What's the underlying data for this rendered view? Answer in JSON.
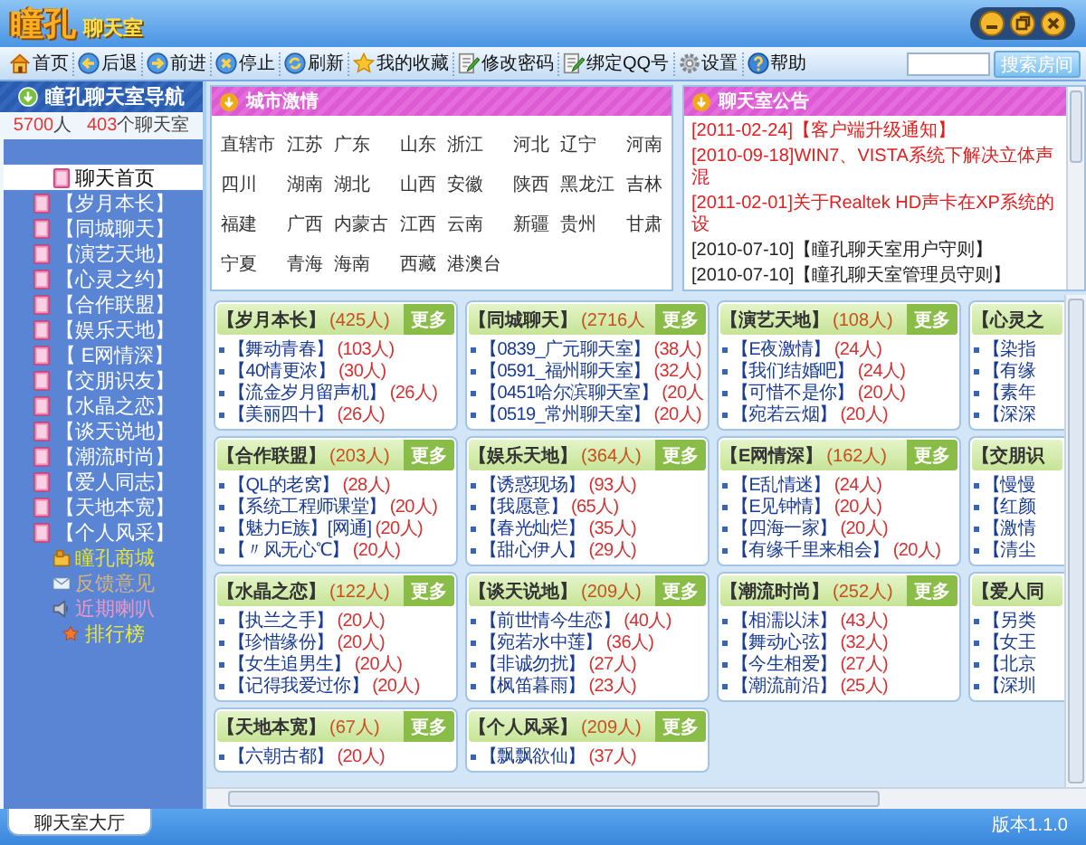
{
  "app": {
    "logo": "瞳孔",
    "logo_sub": "聊天室"
  },
  "toolbar": [
    {
      "label": "首页",
      "kind": "home"
    },
    {
      "label": "后退",
      "kind": "back"
    },
    {
      "label": "前进",
      "kind": "forward"
    },
    {
      "label": "停止",
      "kind": "stop"
    },
    {
      "label": "刷新",
      "kind": "refresh"
    },
    {
      "label": "我的收藏",
      "kind": "star"
    },
    {
      "label": "修改密码",
      "kind": "edit"
    },
    {
      "label": "绑定QQ号",
      "kind": "edit"
    },
    {
      "label": "设置",
      "kind": "gear"
    },
    {
      "label": "帮助",
      "kind": "help"
    }
  ],
  "search": {
    "button": "搜索房间"
  },
  "sidebar": {
    "title": "瞳孔聊天室导航",
    "users": "5700",
    "users_unit": "人",
    "rooms": "403",
    "rooms_unit": "个聊天室",
    "items": [
      {
        "label": "聊天首页",
        "kind": "room",
        "selected": true
      },
      {
        "label": "【岁月本长】",
        "kind": "room",
        "selected": false
      },
      {
        "label": "【同城聊天】",
        "kind": "room",
        "selected": false
      },
      {
        "label": "【演艺天地】",
        "kind": "room",
        "selected": false
      },
      {
        "label": "【心灵之约】",
        "kind": "room",
        "selected": false
      },
      {
        "label": "【合作联盟】",
        "kind": "room",
        "selected": false
      },
      {
        "label": "【娱乐天地】",
        "kind": "room",
        "selected": false
      },
      {
        "label": "【 E网情深】",
        "kind": "room",
        "selected": false
      },
      {
        "label": "【交朋识友】",
        "kind": "room",
        "selected": false
      },
      {
        "label": "【水晶之恋】",
        "kind": "room",
        "selected": false
      },
      {
        "label": "【谈天说地】",
        "kind": "room",
        "selected": false
      },
      {
        "label": "【潮流时尚】",
        "kind": "room",
        "selected": false
      },
      {
        "label": "【爱人同志】",
        "kind": "room",
        "selected": false
      },
      {
        "label": "【天地本宽】",
        "kind": "room",
        "selected": false
      },
      {
        "label": "【个人风采】",
        "kind": "room",
        "selected": false
      },
      {
        "label": "瞳孔商城",
        "kind": "shop",
        "selected": false,
        "color": "#e4e436"
      },
      {
        "label": "反馈意见",
        "kind": "mail",
        "selected": false,
        "color": "#d8b478"
      },
      {
        "label": "近期喇叭",
        "kind": "speaker",
        "selected": false,
        "color": "#e898c8"
      },
      {
        "label": "排行榜",
        "kind": "rank",
        "selected": false,
        "color": "#e8e840"
      }
    ],
    "tab": "聊天室大厅"
  },
  "city_panel": {
    "title": "城市激情",
    "cities": [
      "直辖市",
      "江苏",
      "广东",
      "山东",
      "浙江",
      "河北",
      "辽宁",
      "河南",
      "四川",
      "湖南",
      "湖北",
      "山西",
      "安徽",
      "陕西",
      "黑龙江",
      "吉林",
      "福建",
      "广西",
      "内蒙古",
      "江西",
      "云南",
      "新疆",
      "贵州",
      "甘肃",
      "宁夏",
      "青海",
      "海南",
      "西藏",
      "港澳台"
    ]
  },
  "notice_panel": {
    "title": "聊天室公告",
    "notices": [
      {
        "text": "[2011-02-24]【客户端升级通知】",
        "important": true
      },
      {
        "text": "[2010-09-18]WIN7、VISTA系统下解决立体声混",
        "important": true
      },
      {
        "text": "[2011-02-01]关于Realtek HD声卡在XP系统的设",
        "important": true
      },
      {
        "text": "[2010-07-10]【瞳孔聊天室用户守则】",
        "important": false
      },
      {
        "text": "[2010-07-10]【瞳孔聊天室管理员守则】",
        "important": false
      }
    ]
  },
  "category_rows": [
    [
      {
        "title": "【岁月本长】",
        "count": "(425人)",
        "more": "更多",
        "rooms": [
          {
            "name": "【舞动青春】",
            "count": "(103人)"
          },
          {
            "name": "【40情更浓】",
            "count": "(30人)"
          },
          {
            "name": "【流金岁月留声机】",
            "count": "(26人)"
          },
          {
            "name": "【美丽四十】",
            "count": "(26人)"
          }
        ]
      },
      {
        "title": "【同城聊天】",
        "count": "(2716人",
        "more": "更多",
        "rooms": [
          {
            "name": "【0839_广元聊天室】",
            "count": "(38人)"
          },
          {
            "name": "【0591_福州聊天室】",
            "count": "(32人)"
          },
          {
            "name": "【0451哈尔滨聊天室】",
            "count": "(20人"
          },
          {
            "name": "【0519_常州聊天室】",
            "count": "(20人)"
          }
        ]
      },
      {
        "title": "【演艺天地】",
        "count": "(108人)",
        "more": "更多",
        "rooms": [
          {
            "name": "【E夜激情】",
            "count": "(24人)"
          },
          {
            "name": "【我们结婚吧】",
            "count": "(24人)"
          },
          {
            "name": "【可惜不是你】",
            "count": "(20人)"
          },
          {
            "name": "【宛若云烟】",
            "count": "(20人)"
          }
        ]
      },
      {
        "title": "【心灵之",
        "rooms": [
          {
            "name": "【染指"
          },
          {
            "name": "【有缘"
          },
          {
            "name": "【素年"
          },
          {
            "name": "【深深"
          }
        ]
      }
    ],
    [
      {
        "title": "【合作联盟】",
        "count": "(203人)",
        "more": "更多",
        "rooms": [
          {
            "name": "【QL的老窝】",
            "count": "(28人)"
          },
          {
            "name": "【系统工程师课堂】",
            "count": "(20人)"
          },
          {
            "name": "【魅力E族】[网通]",
            "count": "(20人)"
          },
          {
            "name": "【〃风无心℃】",
            "count": "(20人)"
          }
        ]
      },
      {
        "title": "【娱乐天地】",
        "count": "(364人)",
        "more": "更多",
        "rooms": [
          {
            "name": "【诱惑现场】",
            "count": "(93人)"
          },
          {
            "name": "【我愿意】",
            "count": "(65人)"
          },
          {
            "name": "【春光灿烂】",
            "count": "(35人)"
          },
          {
            "name": "【甜心伊人】",
            "count": "(29人)"
          }
        ]
      },
      {
        "title": "【E网情深】",
        "count": "(162人)",
        "more": "更多",
        "rooms": [
          {
            "name": "【E乱情迷】",
            "count": "(24人)"
          },
          {
            "name": "【E见钟情】",
            "count": "(20人)"
          },
          {
            "name": "【四海一家】",
            "count": "(20人)"
          },
          {
            "name": "【有缘千里来相会】",
            "count": "(20人)"
          }
        ]
      },
      {
        "title": "【交朋识",
        "rooms": [
          {
            "name": "【慢慢"
          },
          {
            "name": "【红颜"
          },
          {
            "name": "【激情"
          },
          {
            "name": "【清尘"
          }
        ]
      }
    ],
    [
      {
        "title": "【水晶之恋】",
        "count": "(122人)",
        "more": "更多",
        "rooms": [
          {
            "name": "【执兰之手】",
            "count": "(20人)"
          },
          {
            "name": "【珍惜缘份】",
            "count": "(20人)"
          },
          {
            "name": "【女生追男生】",
            "count": "(20人)"
          },
          {
            "name": "【记得我爱过你】",
            "count": "(20人)"
          }
        ]
      },
      {
        "title": "【谈天说地】",
        "count": "(209人)",
        "more": "更多",
        "rooms": [
          {
            "name": "【前世情今生恋】",
            "count": "(40人)"
          },
          {
            "name": "【宛若水中莲】",
            "count": "(36人)"
          },
          {
            "name": "【非诚勿扰】",
            "count": "(27人)"
          },
          {
            "name": "【枫笛暮雨】",
            "count": "(23人)"
          }
        ]
      },
      {
        "title": "【潮流时尚】",
        "count": "(252人)",
        "more": "更多",
        "rooms": [
          {
            "name": "【相濡以沫】",
            "count": "(43人)"
          },
          {
            "name": "【舞动心弦】",
            "count": "(32人)"
          },
          {
            "name": "【今生相爱】",
            "count": "(27人)"
          },
          {
            "name": "【潮流前沿】",
            "count": "(25人)"
          }
        ]
      },
      {
        "title": "【爱人同",
        "rooms": [
          {
            "name": "【另类"
          },
          {
            "name": "【女王"
          },
          {
            "name": "【北京"
          },
          {
            "name": "【深圳"
          }
        ]
      }
    ],
    [
      {
        "title": "【天地本宽】",
        "count": "(67人)",
        "more": "更多",
        "rooms": [
          {
            "name": "【六朝古都】",
            "count": "(20人)"
          }
        ]
      },
      {
        "title": "【个人风采】",
        "count": "(209人)",
        "more": "更多",
        "rooms": [
          {
            "name": "【飘飘欲仙】",
            "count": "(37人)"
          }
        ]
      }
    ]
  ],
  "status_bar": {
    "version": "版本1.1.0"
  }
}
